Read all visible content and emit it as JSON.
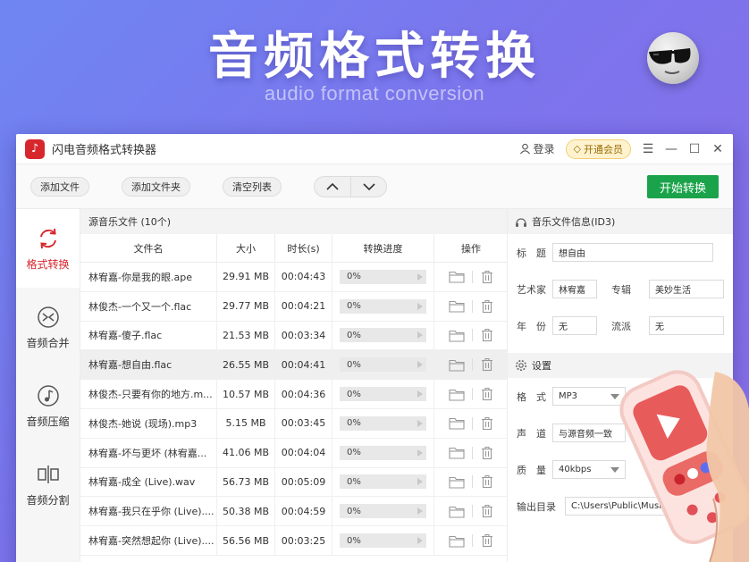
{
  "hero": {
    "title": "音频格式转换",
    "subtitle": "audio format conversion"
  },
  "window": {
    "title": "闪电音频格式转换器",
    "login_label": "登录",
    "vip_label": "开通会员",
    "controls": [
      "☰",
      "—",
      "☐",
      "✕"
    ]
  },
  "toolbar": {
    "add_file": "添加文件",
    "add_folder": "添加文件夹",
    "clear_list": "清空列表",
    "start": "开始转换"
  },
  "sidebar": {
    "items": [
      {
        "label": "格式转换",
        "icon": "refresh-icon",
        "active": true
      },
      {
        "label": "音频合并",
        "icon": "merge-icon",
        "active": false
      },
      {
        "label": "音频压缩",
        "icon": "music-note-icon",
        "active": false
      },
      {
        "label": "音频分割",
        "icon": "split-icon",
        "active": false
      }
    ]
  },
  "list": {
    "header": "源音乐文件 (10个)",
    "columns": [
      "文件名",
      "大小",
      "时长(s)",
      "转换进度",
      "操作"
    ],
    "rows": [
      {
        "name": "林宥嘉-你是我的眼.ape",
        "size": "29.91 MB",
        "duration": "00:04:43",
        "progress": "0%",
        "progress_value": 0
      },
      {
        "name": "林俊杰-一个又一个.flac",
        "size": "29.77 MB",
        "duration": "00:04:21",
        "progress": "0%",
        "progress_value": 0
      },
      {
        "name": "林宥嘉-傻子.flac",
        "size": "21.53 MB",
        "duration": "00:03:34",
        "progress": "0%",
        "progress_value": 0
      },
      {
        "name": "林宥嘉-想自由.flac",
        "size": "26.55 MB",
        "duration": "00:04:41",
        "progress": "0%",
        "progress_value": 0,
        "selected": true
      },
      {
        "name": "林俊杰-只要有你的地方.m...",
        "size": "10.57 MB",
        "duration": "00:04:36",
        "progress": "0%",
        "progress_value": 0
      },
      {
        "name": "林俊杰-她说 (现场).mp3",
        "size": "5.15 MB",
        "duration": "00:03:45",
        "progress": "0%",
        "progress_value": 0
      },
      {
        "name": "林宥嘉-坏与更坏 (林宥嘉...",
        "size": "41.06 MB",
        "duration": "00:04:04",
        "progress": "0%",
        "progress_value": 0
      },
      {
        "name": "林宥嘉-成全 (Live).wav",
        "size": "56.73 MB",
        "duration": "00:05:09",
        "progress": "0%",
        "progress_value": 0
      },
      {
        "name": "林宥嘉-我只在乎你 (Live)....",
        "size": "50.38 MB",
        "duration": "00:04:59",
        "progress": "0%",
        "progress_value": 0
      },
      {
        "name": "林宥嘉-突然想起你 (Live)....",
        "size": "56.56 MB",
        "duration": "00:03:25",
        "progress": "0%",
        "progress_value": 0
      }
    ]
  },
  "info": {
    "header": "音乐文件信息(ID3)",
    "title_label": "标　题",
    "title_value": "想自由",
    "artist_label": "艺术家",
    "artist_value": "林宥嘉",
    "album_label": "专辑",
    "album_value": "美妙生活",
    "year_label": "年　份",
    "year_value": "无",
    "genre_label": "流派",
    "genre_value": "无"
  },
  "settings": {
    "header": "设置",
    "format_label": "格　式",
    "format_value": "MP3",
    "channel_label": "声　道",
    "channel_value": "与源音频一致",
    "quality_label": "质　量",
    "quality_value": "40kbps",
    "output_label": "输出目录",
    "output_value": "C:\\Users\\Public\\Music\\"
  },
  "colors": {
    "accent_red": "#d8262d",
    "start_green": "#1aa34a",
    "vip_gold": "#f2cf72"
  }
}
